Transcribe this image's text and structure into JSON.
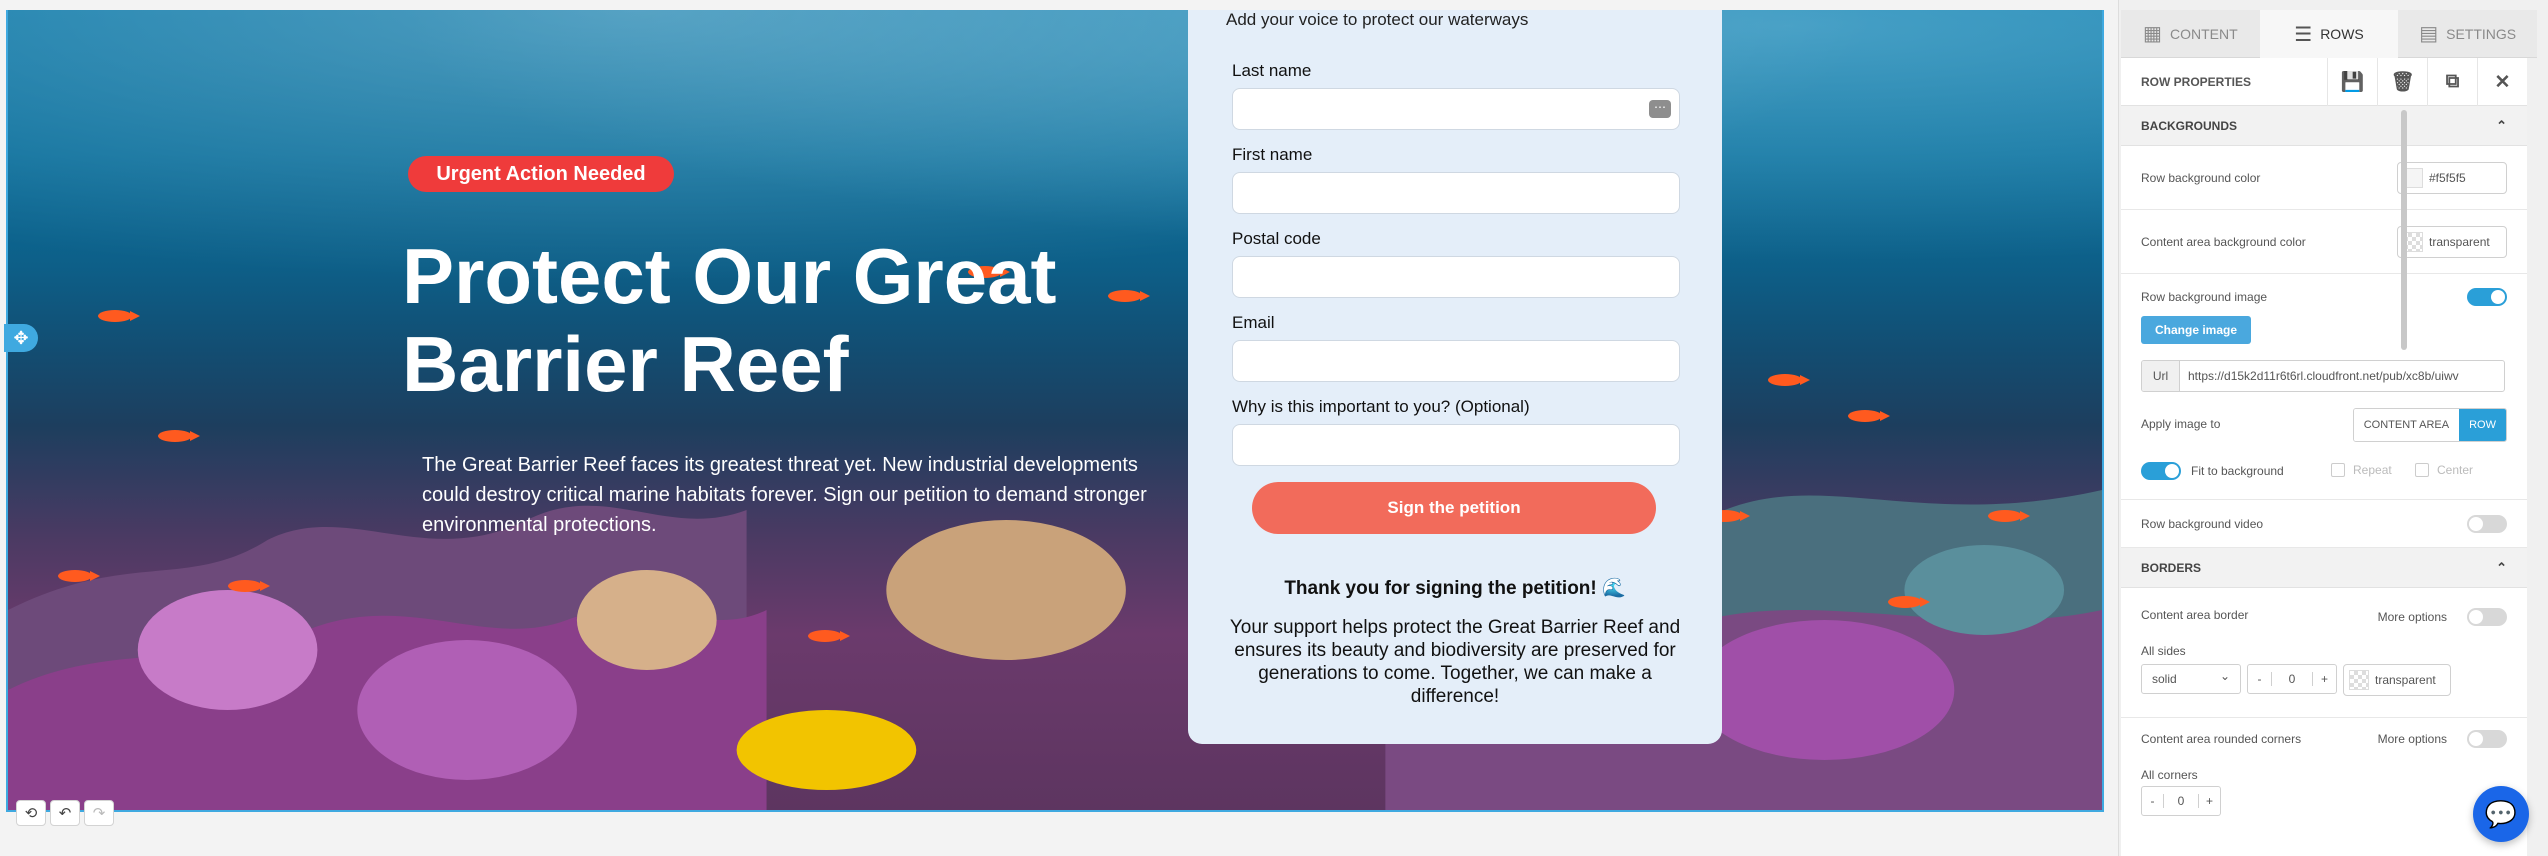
{
  "hero": {
    "badge": "Urgent Action Needed",
    "headline": "Protect Our Great Barrier Reef",
    "lead": "The Great Barrier Reef faces its greatest threat yet. New industrial developments could destroy critical marine habitats forever. Sign our petition to demand stronger environmental protections."
  },
  "form": {
    "intro": "Add your voice to protect our waterways",
    "fields": [
      {
        "label": "Last name"
      },
      {
        "label": "First name"
      },
      {
        "label": "Postal code"
      },
      {
        "label": "Email"
      },
      {
        "label": "Why is this important to you? (Optional)"
      }
    ],
    "autofill_icon": "⋯",
    "submit": "Sign the petition",
    "thanks": "Thank you for signing the petition! 🌊",
    "support": "Your support helps protect the Great Barrier Reef and ensures its beauty and biodiversity are preserved for generations to come. Together, we can make a difference!"
  },
  "history": {
    "history_icon": "⟲",
    "undo_icon": "↶",
    "redo_icon": "↷"
  },
  "move_icon": "✥",
  "panel": {
    "tabs": [
      {
        "label": "CONTENT",
        "icon": "▦"
      },
      {
        "label": "ROWS",
        "icon": "☰"
      },
      {
        "label": "SETTINGS",
        "icon": "▤"
      }
    ],
    "header": "ROW PROPERTIES",
    "header_icons": {
      "save": "💾",
      "delete": "🗑",
      "duplicate": "⧉",
      "close": "✕"
    },
    "backgrounds": {
      "title": "BACKGROUNDS",
      "row_bg_color_label": "Row background color",
      "row_bg_color_value": "#f5f5f5",
      "content_bg_label": "Content area background color",
      "content_bg_value": "transparent",
      "row_bg_image_label": "Row background image",
      "change_image": "Change image",
      "url_prefix": "Url",
      "url_value": "https://d15k2d11r6t6rl.cloudfront.net/pub/xc8b/uiwv",
      "apply_label": "Apply image to",
      "apply_options": [
        "CONTENT AREA",
        "ROW"
      ],
      "fit_label": "Fit to background",
      "repeat_label": "Repeat",
      "center_label": "Center",
      "row_bg_video_label": "Row background video"
    },
    "borders": {
      "title": "BORDERS",
      "content_border_label": "Content area border",
      "more_options": "More options",
      "all_sides_label": "All sides",
      "style_value": "solid",
      "minus": "-",
      "plus": "+",
      "width_value": "0",
      "color_value": "transparent",
      "rounded_label": "Content area rounded corners",
      "more_options_2": "More options",
      "all_corners_label": "All corners",
      "radius_value": "0"
    },
    "chevron_up": "⌃",
    "chevron_down": "⌄"
  },
  "chat_icon": "💬",
  "colors": {
    "accent": "#2a9fd8",
    "badge": "#ef3b3b",
    "submit": "#f26b5b",
    "chat": "#1a66e8"
  }
}
